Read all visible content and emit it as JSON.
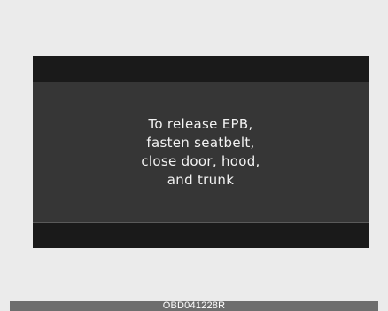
{
  "display": {
    "message_lines": [
      "To release EPB,",
      "fasten seatbelt,",
      "close door, hood,",
      "and trunk"
    ]
  },
  "caption": {
    "code": "OBD041228R"
  },
  "colors": {
    "background": "#ebebeb",
    "display_frame": "#1a1a1a",
    "display_body": "#363636",
    "text": "#f2f2f2",
    "caption_bar": "#6e6e6e"
  }
}
